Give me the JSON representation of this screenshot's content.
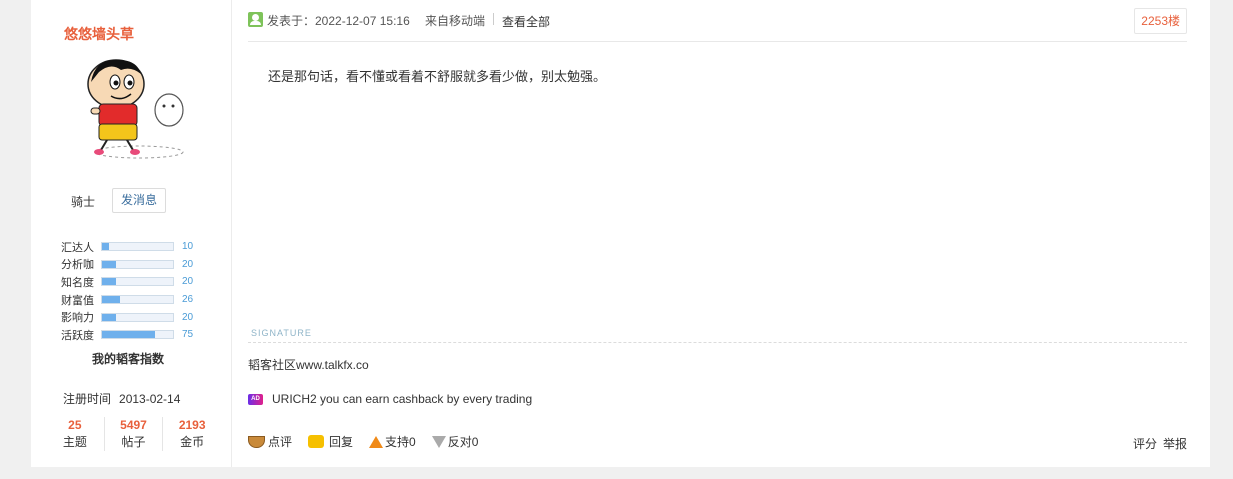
{
  "user": {
    "name": "悠悠墙头草",
    "rank": "骑士",
    "message_button": "发消息",
    "stats": [
      {
        "label": "汇达人",
        "value": "10",
        "fraction": 0.1
      },
      {
        "label": "分析咖",
        "value": "20",
        "fraction": 0.2
      },
      {
        "label": "知名度",
        "value": "20",
        "fraction": 0.2
      },
      {
        "label": "财富值",
        "value": "26",
        "fraction": 0.26
      },
      {
        "label": "影响力",
        "value": "20",
        "fraction": 0.2
      },
      {
        "label": "活跃度",
        "value": "75",
        "fraction": 0.75
      }
    ],
    "index_title": "我的韬客指数",
    "register_label": "注册时间",
    "register_date": "2013-02-14",
    "counts": [
      {
        "num": "25",
        "label": "主题"
      },
      {
        "num": "5497",
        "label": "帖子"
      },
      {
        "num": "2193",
        "label": "金币"
      }
    ]
  },
  "post": {
    "time": "发表于：2022-12-07 15:16",
    "from": "来自移动端",
    "view_all": "查看全部",
    "floor": "2253楼",
    "content": "还是那句话，看不懂或看着不舒服就多看少做，别太勉强。",
    "signature_label": "SIGNATURE",
    "signature": "韬客社区www.talkfx.co",
    "ad_badge": "AD",
    "ad_text": "URICH2 you can earn cashback by every trading"
  },
  "actions": {
    "rate": "点评",
    "reply": "回复",
    "support": "支持0",
    "oppose": "反对0",
    "score": "评分",
    "report": "举报"
  },
  "colors": {
    "accent": "#e8603c",
    "bar_fill": "#6fb0ec",
    "link": "#3a6e9e"
  }
}
